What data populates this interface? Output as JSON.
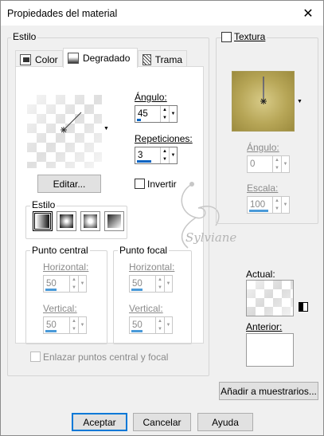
{
  "window": {
    "title": "Propiedades del material",
    "close_glyph": "✕"
  },
  "estilo_group": {
    "label": "Estilo"
  },
  "tabs": [
    {
      "label": "Color",
      "icon": "color-swatch-icon",
      "active": false
    },
    {
      "label": "Degradado",
      "icon": "gradient-icon",
      "active": true
    },
    {
      "label": "Trama",
      "icon": "pattern-icon",
      "active": false
    }
  ],
  "gradient": {
    "angle_label": "Ángulo:",
    "angle_value": "45",
    "repeat_label": "Repeticiones:",
    "repeat_value": "3",
    "edit_button": "Editar...",
    "invert_label": "Invertir",
    "invert_checked": false,
    "style_label": "Estilo",
    "style_buttons": [
      "linear",
      "rectangular",
      "radial",
      "sunburst"
    ],
    "center": {
      "label": "Punto central",
      "horizontal_label": "Horizontal:",
      "horizontal_value": "50",
      "vertical_label": "Vertical:",
      "vertical_value": "50"
    },
    "focal": {
      "label": "Punto focal",
      "horizontal_label": "Horizontal:",
      "horizontal_value": "50",
      "vertical_label": "Vertical:",
      "vertical_value": "50"
    },
    "link_label": "Enlazar puntos central y focal",
    "link_checked": false
  },
  "texture": {
    "label": "Textura",
    "checked": false,
    "angle_label": "Ángulo:",
    "angle_value": "0",
    "scale_label": "Escala:",
    "scale_value": "100"
  },
  "current_label": "Actual:",
  "previous_label": "Anterior:",
  "watermark_text": "Sylviane",
  "add_swatch_button": "Añadir a muestrarios...",
  "footer": {
    "ok": "Aceptar",
    "cancel": "Cancelar",
    "help": "Ayuda"
  },
  "colors": {
    "accent": "#0078d7",
    "texture_gold": "#b9a75a"
  }
}
